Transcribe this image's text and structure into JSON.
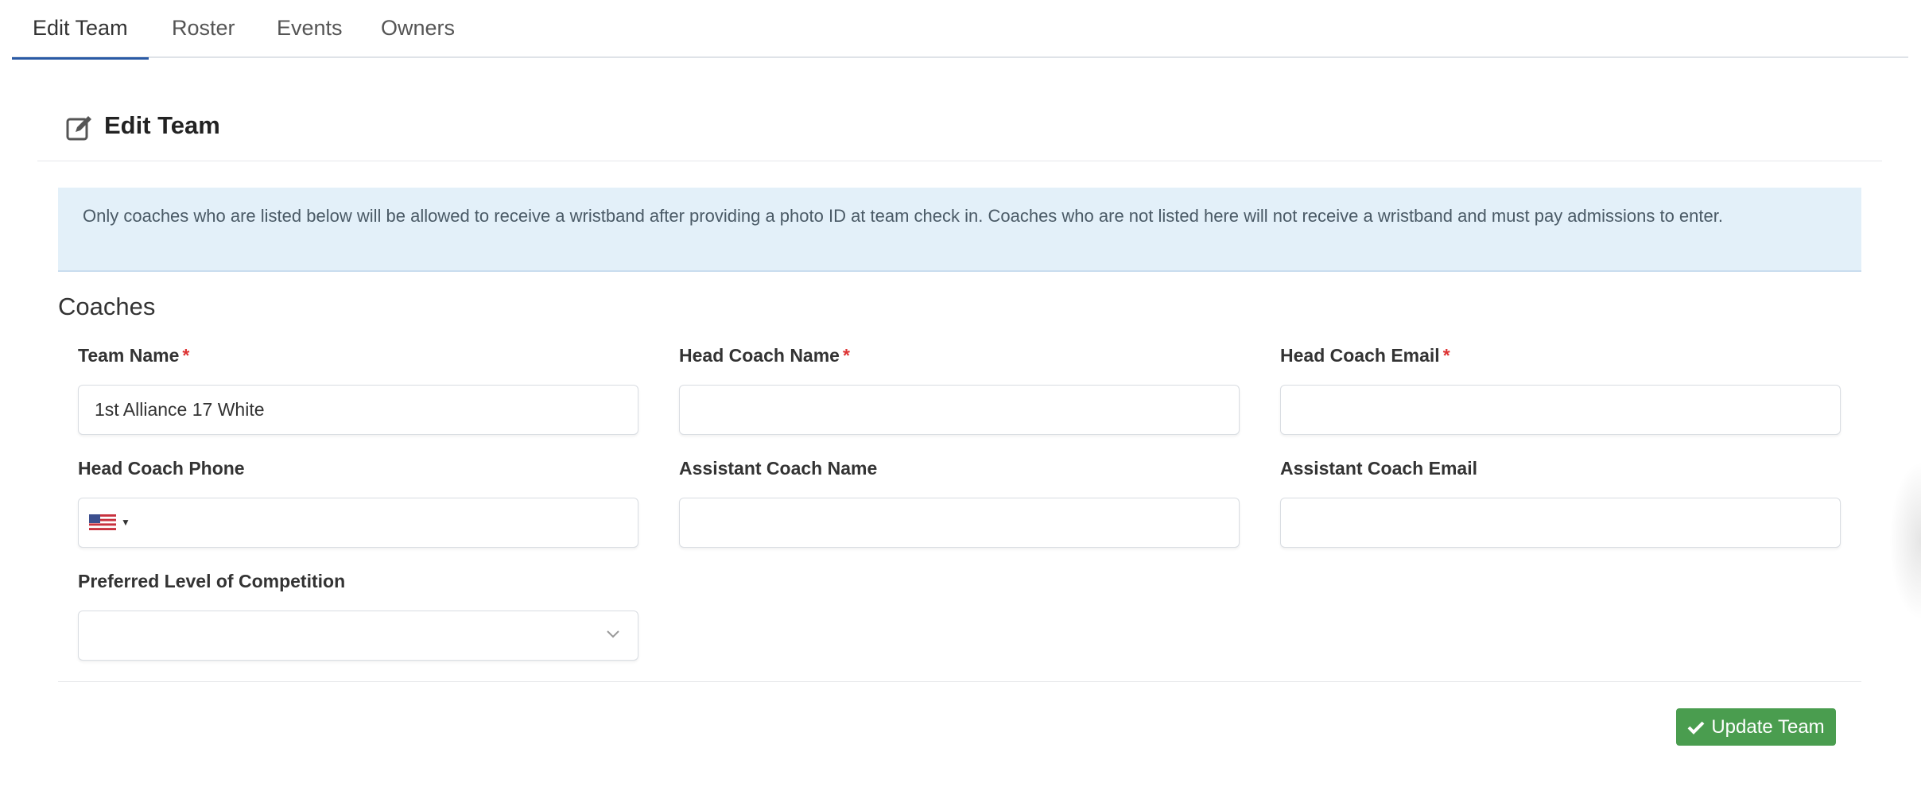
{
  "tabs": [
    {
      "label": "Edit Team",
      "active": true
    },
    {
      "label": "Roster"
    },
    {
      "label": "Events"
    },
    {
      "label": "Owners"
    }
  ],
  "card": {
    "icon": "edit-icon",
    "title": "Edit Team"
  },
  "alert": {
    "text": "Only coaches who are listed below will be allowed to receive a wristband after providing a photo ID at team check in. Coaches who are not listed here will not receive a wristband and must pay admissions to enter."
  },
  "section": {
    "title": "Coaches"
  },
  "fields": {
    "team_name": {
      "label": "Team Name",
      "required": "*",
      "value": "1st Alliance 17 White"
    },
    "head_coach_name": {
      "label": "Head Coach Name",
      "required": "*",
      "value": ""
    },
    "head_coach_email": {
      "label": "Head Coach Email",
      "required": "*",
      "value": ""
    },
    "head_coach_phone": {
      "label": "Head Coach Phone",
      "value": "",
      "flag": "us-flag-icon"
    },
    "assistant_coach_name": {
      "label": "Assistant Coach Name",
      "value": ""
    },
    "assistant_coach_email": {
      "label": "Assistant Coach Email",
      "value": ""
    },
    "preferred_level": {
      "label": "Preferred Level of Competition",
      "value": ""
    }
  },
  "actions": {
    "update_label": "Update Team",
    "update_icon": "check-icon"
  },
  "colors": {
    "accent": "#2a5aa5",
    "alert_bg": "#e3f0f9",
    "required": "#dd3333",
    "button": "#4a9d4f"
  }
}
